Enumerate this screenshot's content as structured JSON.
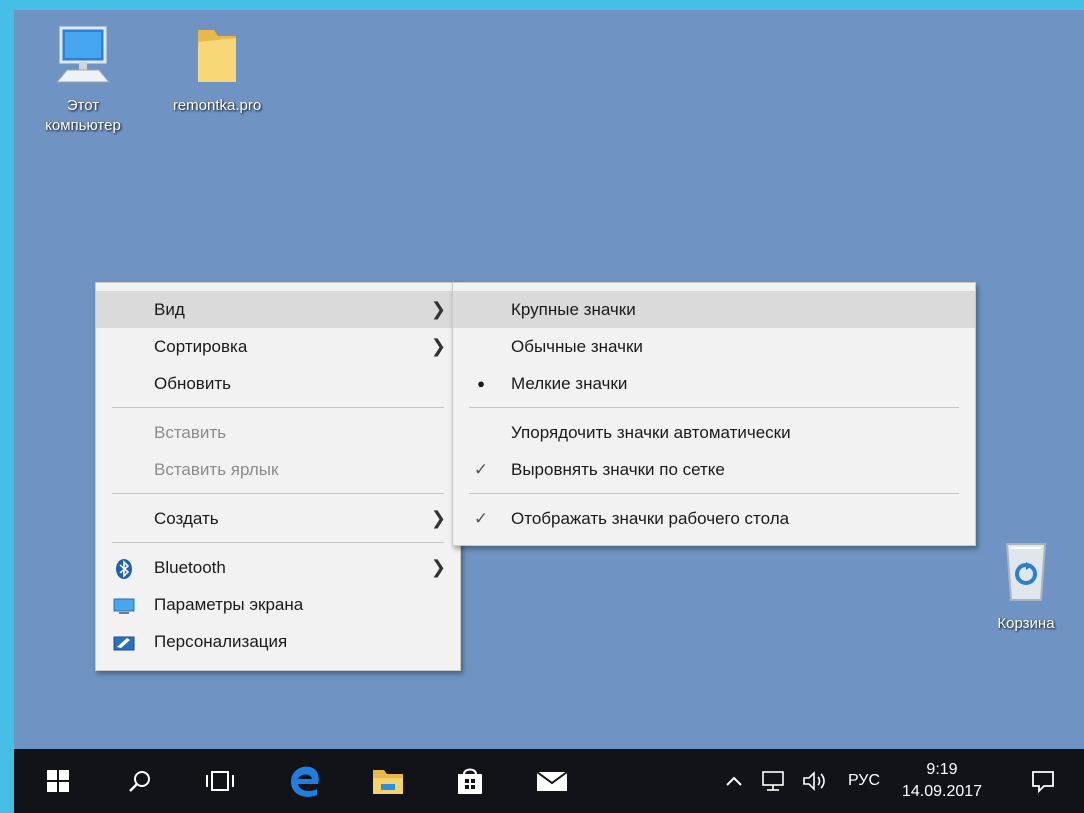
{
  "desktop": {
    "icons": [
      {
        "label_line1": "Этот",
        "label_line2": "компьютер",
        "icon": "computer-icon"
      },
      {
        "label": "remontka.pro",
        "icon": "folder-icon"
      },
      {
        "label": "Корзина",
        "icon": "recycle-bin-icon"
      }
    ]
  },
  "context_menu": {
    "items": [
      {
        "label": "Вид",
        "submenu": true,
        "highlighted": true
      },
      {
        "label": "Сортировка",
        "submenu": true
      },
      {
        "label": "Обновить"
      },
      {
        "label": "Вставить",
        "disabled": true
      },
      {
        "label": "Вставить ярлык",
        "disabled": true
      },
      {
        "label": "Создать",
        "submenu": true
      },
      {
        "label": "Bluetooth",
        "submenu": true,
        "icon": "bluetooth-icon"
      },
      {
        "label": "Параметры экрана",
        "icon": "display-icon"
      },
      {
        "label": "Персонализация",
        "icon": "personalization-icon"
      }
    ]
  },
  "view_submenu": {
    "items": [
      {
        "label": "Крупные значки",
        "highlighted": true
      },
      {
        "label": "Обычные значки"
      },
      {
        "label": "Мелкие значки",
        "mark": "●"
      },
      {
        "label": "Упорядочить значки автоматически"
      },
      {
        "label": "Выровнять значки по сетке",
        "mark": "✓"
      },
      {
        "label": "Отображать значки рабочего стола",
        "mark": "✓"
      }
    ]
  },
  "taskbar": {
    "language": "РУС",
    "time": "9:19",
    "date": "14.09.2017",
    "icons": [
      "windows-start-icon",
      "search-icon",
      "task-view-icon",
      "edge-icon",
      "file-explorer-icon",
      "store-icon",
      "mail-icon"
    ],
    "tray_icons": [
      "chevron-up-icon",
      "network-icon",
      "volume-icon",
      "notifications-icon"
    ]
  },
  "colors": {
    "desktop": "#6f94c4",
    "menu_bg": "#f2f2f2",
    "taskbar": "#111318",
    "frame": "#46bfe6"
  }
}
